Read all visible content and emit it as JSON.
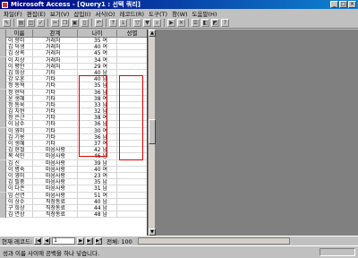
{
  "window": {
    "title": "Microsoft Access - [Query1 : 선택 쿼리]"
  },
  "menu": [
    "파일(F)",
    "편집(E)",
    "보기(V)",
    "삽입(I)",
    "서식(O)",
    "레코드(R)",
    "도구(T)",
    "창(W)",
    "도움말(H)"
  ],
  "table": {
    "headers": [
      "이름",
      "관계",
      "나이",
      "성별"
    ],
    "rows": [
      [
        "이 향미",
        "거래처",
        "35 여",
        ""
      ],
      [
        "김 덕생",
        "거래처",
        "40 여",
        ""
      ],
      [
        "김 상록",
        "거래처",
        "45 여",
        ""
      ],
      [
        "이 지상",
        "거래처",
        "34 여",
        ""
      ],
      [
        "이 평안",
        "거래처",
        "29 여",
        ""
      ],
      [
        "김 희상",
        "기타",
        "40 남",
        ""
      ],
      [
        "강 우혼",
        "기타",
        "40 남",
        ""
      ],
      [
        "정 동혁",
        "기타",
        "35 남",
        ""
      ],
      [
        "정 현덕",
        "기타",
        "36 남",
        ""
      ],
      [
        "윤 생혜",
        "기타",
        "38 여",
        ""
      ],
      [
        "정 동욱",
        "기타",
        "33 남",
        ""
      ],
      [
        "김 치현",
        "기타",
        "32 남",
        ""
      ],
      [
        "정 은근",
        "기타",
        "38 여",
        ""
      ],
      [
        "이 남수",
        "기타",
        "36 남",
        ""
      ],
      [
        "이 영미",
        "기타",
        "30 여",
        ""
      ],
      [
        "김 기용",
        "기타",
        "36 남",
        ""
      ],
      [
        "이 생혜",
        "기타",
        "37 여",
        ""
      ],
      [
        "김 현철",
        "마음사랑",
        "42 남",
        ""
      ],
      [
        "복 석민",
        "마음사랑",
        "46 남",
        ""
      ],
      [
        "김 신",
        "마음사랑",
        "39 남",
        ""
      ],
      [
        "이 병숙",
        "마음사랑",
        "40 여",
        ""
      ],
      [
        "이 영미",
        "마음사랑",
        "23 여",
        ""
      ],
      [
        "김 필중",
        "마음사랑",
        "35 남",
        ""
      ],
      [
        "이 다은",
        "마음사랑",
        "31 남",
        ""
      ],
      [
        "임 선연",
        "마음사랑",
        "51 여",
        ""
      ],
      [
        "이 상수",
        "직장동료",
        "40 남",
        ""
      ],
      [
        "구 희상",
        "직장동료",
        "44 남",
        ""
      ],
      [
        "김 연상",
        "직장동료",
        "48 남",
        ""
      ]
    ]
  },
  "nav": {
    "label": "현재 레코드:",
    "record": "1",
    "total": "전체: 100",
    "first": "|◀",
    "prev": "◀",
    "next": "▶",
    "last": "▶|",
    "new": "▶*"
  },
  "status": {
    "text": "성과 이름 사이에 공백을 하나 넣습니다."
  },
  "toolbar_icons": [
    "design-view",
    "print",
    "preview",
    "spell",
    "cut",
    "copy",
    "paste",
    "format-painter",
    "undo",
    "sort-asc",
    "sort-desc",
    "filter",
    "apply-filter",
    "find",
    "new-record",
    "delete-record",
    "properties",
    "database",
    "new-object",
    "help"
  ],
  "colors": {
    "titlebar": "#000080",
    "highlight": "#e00000"
  }
}
